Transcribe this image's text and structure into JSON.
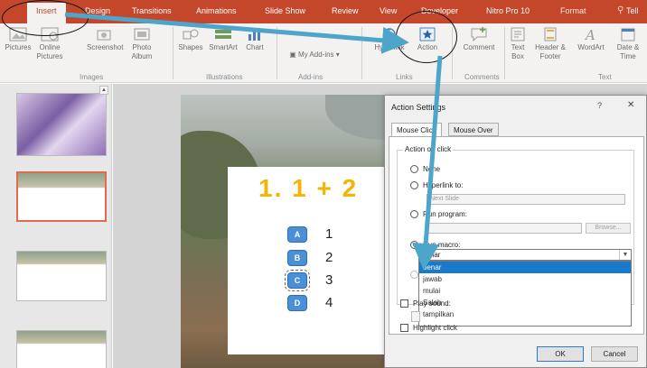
{
  "ribbon_tabs": [
    "Insert",
    "Design",
    "Transitions",
    "Animations",
    "Slide Show",
    "Review",
    "View",
    "Developer",
    "Nitro Pro 10",
    "Format",
    "Tell"
  ],
  "ribbon": {
    "images_group": {
      "label": "Images",
      "items": [
        "Pictures",
        "Online Pictures",
        "Screenshot",
        "Photo Album"
      ]
    },
    "illustrations_group": {
      "label": "Illustrations",
      "items": [
        "Shapes",
        "SmartArt",
        "Chart"
      ]
    },
    "addins_group": {
      "label": "Add-ins",
      "items": [
        "My Add-ins"
      ]
    },
    "links_group": {
      "label": "Links",
      "items": [
        "Hyperlink",
        "Action"
      ]
    },
    "comments_group": {
      "label": "Comments",
      "items": [
        "Comment"
      ]
    },
    "text_group": {
      "label": "Text",
      "items": [
        "Text Box",
        "Header & Footer",
        "WordArt",
        "Date & Time"
      ]
    }
  },
  "slide": {
    "question": "1. 1 + 2",
    "options": [
      {
        "letter": "A",
        "number": "1"
      },
      {
        "letter": "B",
        "number": "2"
      },
      {
        "letter": "C",
        "number": "3"
      },
      {
        "letter": "D",
        "number": "4"
      }
    ]
  },
  "dialog": {
    "title": "Action Settings",
    "help": "?",
    "close": "✕",
    "tabs": [
      "Mouse Click",
      "Mouse Over"
    ],
    "group_title": "Action on click",
    "radio_none": "None",
    "radio_hyperlink": "Hyperlink to:",
    "hyperlink_value": "Next Slide",
    "radio_program": "Run program:",
    "browse_label": "Browse...",
    "radio_macro": "Run macro:",
    "macro_value": "benar",
    "macro_options": [
      "benar",
      "jawab",
      "mulai",
      "Salah",
      "tampilkan"
    ],
    "play_sound_label": "Play sound:",
    "highlight_label": "Highlight click",
    "ok_label": "OK",
    "cancel_label": "Cancel"
  }
}
